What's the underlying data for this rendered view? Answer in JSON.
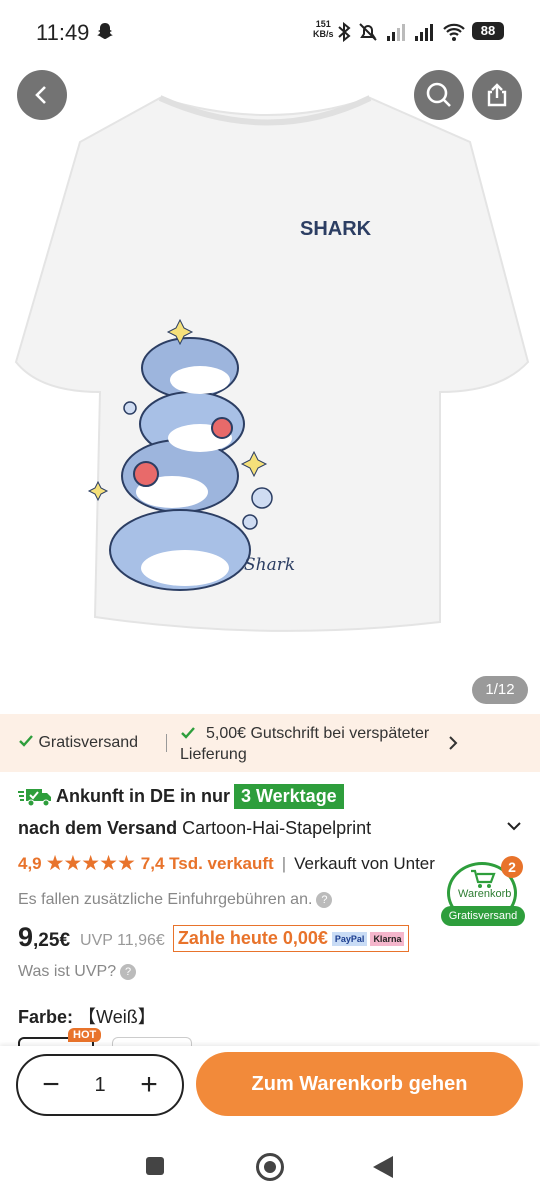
{
  "statusbar": {
    "time": "11:49",
    "rate": "151",
    "rate_unit": "KB/s",
    "battery": "88"
  },
  "hero": {
    "counter": "1/12",
    "print_text": "SHARK",
    "signature": "Shark"
  },
  "benefits": {
    "free_shipping": "Gratisversand",
    "credit": "5,00€ Gutschrift bei verspäteter Lieferung"
  },
  "delivery": {
    "prefix": "Ankunft in DE in nur",
    "days": "3 Werktage"
  },
  "title": {
    "after_shipping": "nach dem Versand",
    "name": "Cartoon-Hai-Stapelprint"
  },
  "rating": {
    "score": "4,9",
    "stars": "★★★★★",
    "sold": "7,4 Tsd. verkauft",
    "sold_by": "Verkauft von Unter"
  },
  "import_note": "Es fallen zusätzliche Einfuhrgebühren an.",
  "price": {
    "whole": "9",
    "fraction": ",25€",
    "uvp": "UVP 11,96€",
    "pay_today": "Zahle heute 0,00€",
    "paypal": "PayPal",
    "klarna": "Klarna",
    "uvp_question": "Was ist UVP?"
  },
  "color": {
    "label": "Farbe:",
    "value": "【Weiß】",
    "hot_badge": "HOT"
  },
  "cart": {
    "count": "2",
    "label": "Warenkorb",
    "badge": "Gratisversand"
  },
  "actions": {
    "minus": "−",
    "quantity": "1",
    "plus": "+",
    "add_to_cart": "Zum Warenkorb gehen"
  },
  "colors": {
    "accent": "#f28a3a",
    "green": "#2e9e3c",
    "strip_bg": "#fdf0e6"
  }
}
